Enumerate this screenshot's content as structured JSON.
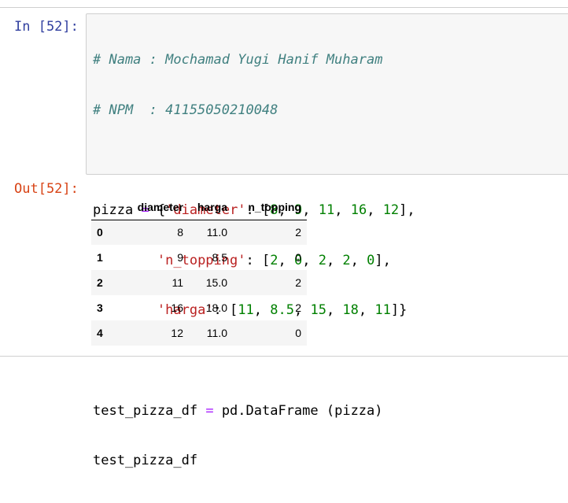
{
  "cell": {
    "in_prompt": "In [52]:",
    "out_prompt": "Out[52]:",
    "code": {
      "comment1": "# Nama : Mochamad Yugi Hanif Muharam",
      "comment2": "# NPM  : 41155050210048",
      "var_pizza": "pizza",
      "assign": "=",
      "open_brace": "{",
      "key_diameter": "'diameter'",
      "key_n_topping": "'n_topping'",
      "key_harga": "'harga'",
      "colon": ": ",
      "diameter_values": [
        "8",
        "9",
        "11",
        "16",
        "12"
      ],
      "n_topping_values": [
        "2",
        "0",
        "2",
        "2",
        "0"
      ],
      "harga_values": [
        "11",
        "8.5",
        "15",
        "18",
        "11"
      ],
      "var_df": "test_pizza_df",
      "call": "pd.DataFrame (pizza)",
      "last_line": "test_pizza_df"
    }
  },
  "dataframe": {
    "columns": [
      "diameter",
      "harga",
      "n_topping"
    ],
    "rows": [
      {
        "index": "0",
        "diameter": "8",
        "harga": "11.0",
        "n_topping": "2"
      },
      {
        "index": "1",
        "diameter": "9",
        "harga": "8.5",
        "n_topping": "0"
      },
      {
        "index": "2",
        "diameter": "11",
        "harga": "15.0",
        "n_topping": "2"
      },
      {
        "index": "3",
        "diameter": "16",
        "harga": "18.0",
        "n_topping": "2"
      },
      {
        "index": "4",
        "diameter": "12",
        "harga": "11.0",
        "n_topping": "0"
      }
    ]
  },
  "colors": {
    "in_prompt": "#303f9f",
    "out_prompt": "#d84315",
    "comment": "#408080",
    "string": "#ba2121",
    "number": "#008000",
    "operator": "#aa22ff",
    "input_bg": "#f7f7f7"
  }
}
